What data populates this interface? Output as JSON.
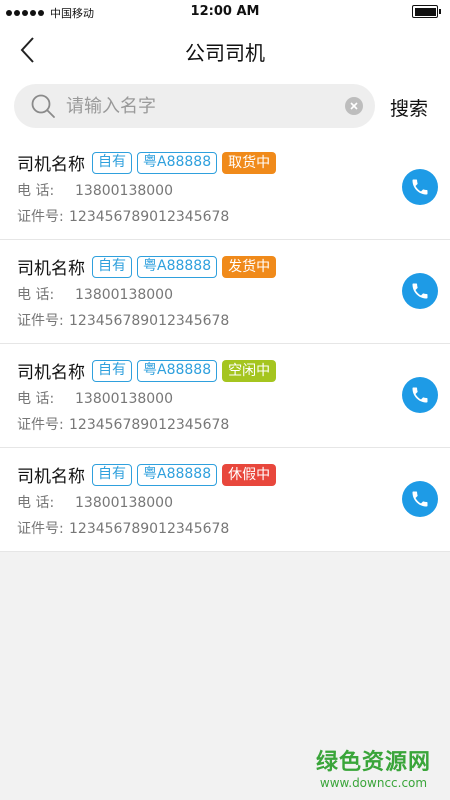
{
  "status_bar": {
    "carrier": "中国移动",
    "time": "12:00 AM",
    "battery_level": 1.0
  },
  "nav": {
    "title": "公司司机",
    "back_icon": "chevron-left-icon"
  },
  "search": {
    "placeholder": "请输入名字",
    "value": "",
    "button_label": "搜索"
  },
  "colors": {
    "accent": "#1e9be6",
    "tag_blue": "#2fa0dd"
  },
  "drivers": [
    {
      "name": "司机名称",
      "ownership": "自有",
      "plate": "粤A88888",
      "status": "取货中",
      "status_color": "#f08a1a",
      "phone_label": "电    话:",
      "phone": "13800138000",
      "id_label": "证件号:",
      "id_number": "123456789012345678"
    },
    {
      "name": "司机名称",
      "ownership": "自有",
      "plate": "粤A88888",
      "status": "发货中",
      "status_color": "#f08a1a",
      "phone_label": "电    话:",
      "phone": "13800138000",
      "id_label": "证件号:",
      "id_number": "123456789012345678"
    },
    {
      "name": "司机名称",
      "ownership": "自有",
      "plate": "粤A88888",
      "status": "空闲中",
      "status_color": "#a5c51f",
      "phone_label": "电    话:",
      "phone": "13800138000",
      "id_label": "证件号:",
      "id_number": "123456789012345678"
    },
    {
      "name": "司机名称",
      "ownership": "自有",
      "plate": "粤A88888",
      "status": "休假中",
      "status_color": "#e8473c",
      "phone_label": "电    话:",
      "phone": "13800138000",
      "id_label": "证件号:",
      "id_number": "123456789012345678"
    }
  ],
  "watermark": {
    "main": "绿色资源网",
    "sub": "www.downcc.com"
  }
}
